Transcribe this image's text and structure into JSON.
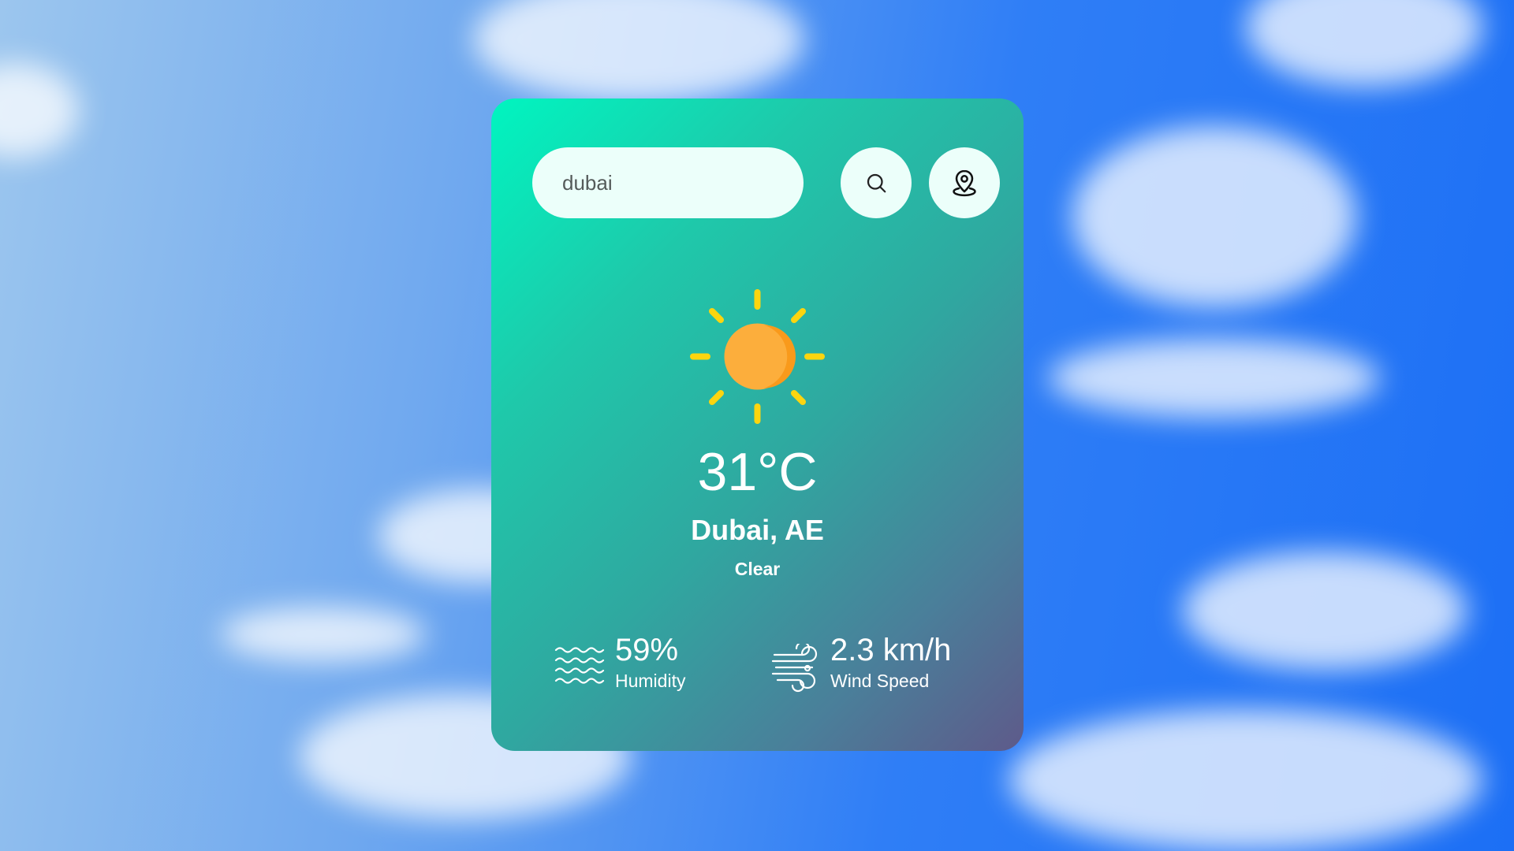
{
  "search": {
    "value": "dubai",
    "search_icon": "search-icon",
    "location_icon": "map-pin-icon"
  },
  "weather": {
    "icon": "sun-icon",
    "temperature": "31°C",
    "location": "Dubai, AE",
    "condition": "Clear"
  },
  "stats": {
    "humidity": {
      "icon": "waves-icon",
      "value": "59%",
      "label": "Humidity"
    },
    "wind": {
      "icon": "wind-icon",
      "value": "2.3 km/h",
      "label": "Wind Speed"
    }
  },
  "colors": {
    "card_gradient_start": "#00f5c0",
    "card_gradient_end": "#5e5a8a",
    "sun_core": "#fcae3c",
    "sun_rays": "#fcd50f",
    "input_bg": "#ecfffa"
  }
}
